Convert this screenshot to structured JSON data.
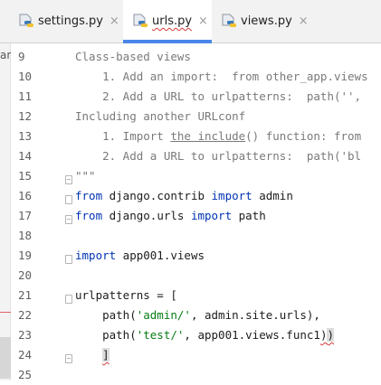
{
  "tabs": [
    {
      "label": "settings.py",
      "close": "×"
    },
    {
      "label": "urls.py",
      "close": "×",
      "active": true
    },
    {
      "label": "views.py",
      "close": "×"
    }
  ],
  "left_edge_text": "an",
  "line_numbers": [
    "9",
    "10",
    "11",
    "12",
    "13",
    "14",
    "15",
    "16",
    "17",
    "18",
    "19",
    "20",
    "21",
    "22",
    "23",
    "24",
    "25"
  ],
  "code": {
    "l9": "Class-based views",
    "l10": "    1. Add an import:  from other_app.views",
    "l11": "    2. Add a URL to urlpatterns:  path('',",
    "l12": "Including another URLconf",
    "l13_a": "    1. Import ",
    "l13_b": "the include",
    "l13_c": "() function: from",
    "l14": "    2. Add a URL to urlpatterns:  path('bl",
    "l15": "\"\"\"",
    "l16_kw1": "from",
    "l16_mod": " django.contrib ",
    "l16_kw2": "import",
    "l16_name": " admin",
    "l17_kw1": "from",
    "l17_mod": " django.urls ",
    "l17_kw2": "import",
    "l17_name": " path",
    "l19_kw": "import",
    "l19_name": " app001.views",
    "l21": "urlpatterns = [",
    "l22_a": "    path(",
    "l22_str": "'admin/'",
    "l22_b": ", admin.site.urls),",
    "l23_a": "    path(",
    "l23_str": "'test/'",
    "l23_b": ", app001.views.func1",
    "l23_c": ")",
    "l23_d": ")",
    "l24_indent": "    ",
    "l24_bracket": "]"
  },
  "colors": {
    "keyword": "#0033b3",
    "string": "#067d17",
    "comment": "#7a7a7a",
    "active_tab_underline": "#4a86e8",
    "error_squiggle": "#d23a3a"
  },
  "icons": {
    "tab_file": "python-file-icon",
    "tab_close": "close-icon"
  }
}
